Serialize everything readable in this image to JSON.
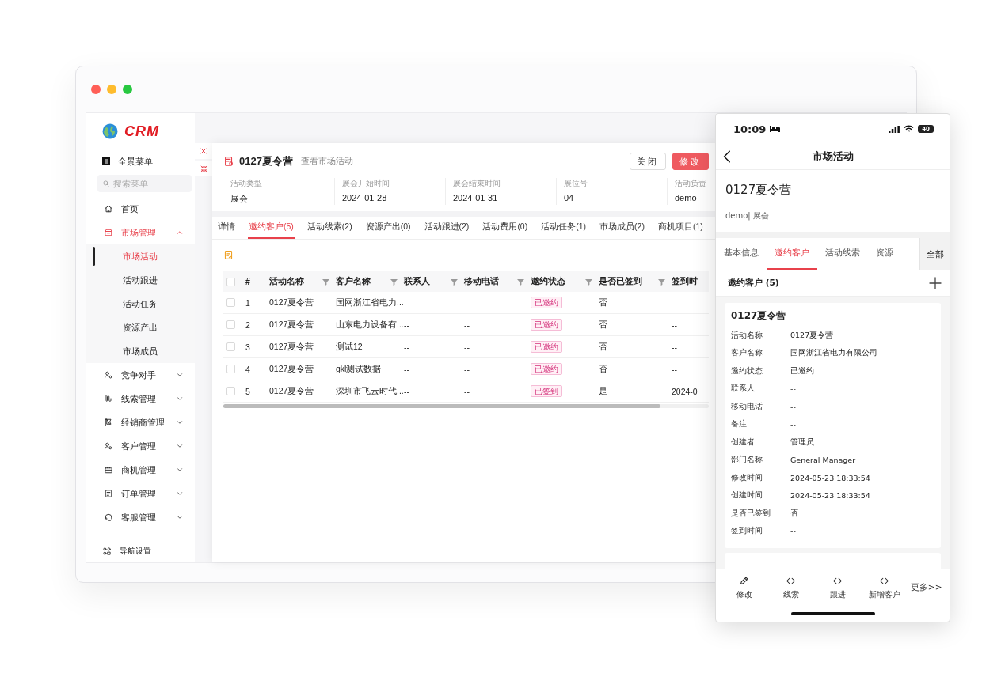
{
  "logo": "CRM",
  "sidebar": {
    "menu_label": "全景菜单",
    "search_placeholder": "搜索菜单",
    "footer": "导航设置",
    "items": [
      {
        "label": "首页",
        "kind": "link"
      },
      {
        "label": "市场管理",
        "kind": "group",
        "expanded": true,
        "children": [
          {
            "label": "市场活动",
            "selected": true
          },
          {
            "label": "活动跟进",
            "selected": false
          },
          {
            "label": "活动任务",
            "selected": false
          },
          {
            "label": "资源产出",
            "selected": false
          },
          {
            "label": "市场成员",
            "selected": false
          }
        ]
      },
      {
        "label": "竞争对手",
        "kind": "group",
        "expanded": false
      },
      {
        "label": "线索管理",
        "kind": "group",
        "expanded": false
      },
      {
        "label": "经销商管理",
        "kind": "group",
        "expanded": false
      },
      {
        "label": "客户管理",
        "kind": "group",
        "expanded": false
      },
      {
        "label": "商机管理",
        "kind": "group",
        "expanded": false
      },
      {
        "label": "订单管理",
        "kind": "group",
        "expanded": false
      },
      {
        "label": "客服管理",
        "kind": "group",
        "expanded": false
      }
    ]
  },
  "drawer": {
    "title": "0127夏令营",
    "subtitle": "查看市场活动",
    "buttons": [
      {
        "label": "关闭",
        "kind": "default"
      },
      {
        "label": "修改",
        "kind": "primary"
      }
    ],
    "fields": [
      {
        "label": "活动类型",
        "value": "展会"
      },
      {
        "label": "展会开始时间",
        "value": "2024-01-28"
      },
      {
        "label": "展会结束时间",
        "value": "2024-01-31"
      },
      {
        "label": "展位号",
        "value": "04"
      },
      {
        "label": "活动负责",
        "value": "demo"
      }
    ],
    "tabs": [
      {
        "label": "详情",
        "selected": false
      },
      {
        "label": "邀约客户(5)",
        "selected": true
      },
      {
        "label": "活动线索(2)",
        "selected": false
      },
      {
        "label": "资源产出(0)",
        "selected": false
      },
      {
        "label": "活动跟进(2)",
        "selected": false
      },
      {
        "label": "活动费用(0)",
        "selected": false
      },
      {
        "label": "活动任务(1)",
        "selected": false
      },
      {
        "label": "市场成员(2)",
        "selected": false
      },
      {
        "label": "商机项目(1)",
        "selected": false
      }
    ],
    "table": {
      "all_checked": false,
      "columns": [
        {
          "label": "#",
          "filter": false
        },
        {
          "label": "活动名称",
          "filter": true
        },
        {
          "label": "客户名称",
          "filter": true
        },
        {
          "label": "联系人",
          "filter": true
        },
        {
          "label": "移动电话",
          "filter": true
        },
        {
          "label": "邀约状态",
          "filter": true
        },
        {
          "label": "是否已签到",
          "filter": true
        },
        {
          "label": "签到时",
          "filter": false
        }
      ],
      "rows": [
        {
          "checked": false,
          "no": "1",
          "activity": "0127夏令营",
          "customer": "国网浙江省电力...",
          "contact": "--",
          "mobile": "--",
          "status": "已邀约",
          "signed_in": "否",
          "sign_time": "--"
        },
        {
          "checked": false,
          "no": "2",
          "activity": "0127夏令营",
          "customer": "山东电力设备有...",
          "contact": "--",
          "mobile": "--",
          "status": "已邀约",
          "signed_in": "否",
          "sign_time": "--"
        },
        {
          "checked": false,
          "no": "3",
          "activity": "0127夏令营",
          "customer": "测试12",
          "contact": "--",
          "mobile": "--",
          "status": "已邀约",
          "signed_in": "否",
          "sign_time": "--"
        },
        {
          "checked": false,
          "no": "4",
          "activity": "0127夏令营",
          "customer": "gkl测试数据",
          "contact": "--",
          "mobile": "--",
          "status": "已邀约",
          "signed_in": "否",
          "sign_time": "--"
        },
        {
          "checked": false,
          "no": "5",
          "activity": "0127夏令营",
          "customer": "深圳市飞云时代...",
          "contact": "--",
          "mobile": "--",
          "status": "已签到",
          "signed_in": "是",
          "sign_time": "2024-0"
        }
      ]
    }
  },
  "phone": {
    "time": "10:09",
    "battery": "40",
    "title": "市场活动",
    "name": "0127夏令营",
    "meta": "demo| 展会",
    "tabs": [
      {
        "label": "基本信息",
        "selected": false
      },
      {
        "label": "邀约客户",
        "selected": true
      },
      {
        "label": "活动线索",
        "selected": false
      },
      {
        "label": "资源",
        "selected": false
      }
    ],
    "all_button": "全部",
    "section": "邀约客户 (5)",
    "card": {
      "title": "0127夏令营",
      "rows": [
        {
          "label": "活动名称",
          "value": "0127夏令营"
        },
        {
          "label": "客户名称",
          "value": "国网浙江省电力有限公司"
        },
        {
          "label": "邀约状态",
          "value": "已邀约"
        },
        {
          "label": "联系人",
          "value": "--"
        },
        {
          "label": "移动电话",
          "value": "--"
        },
        {
          "label": "备注",
          "value": "--"
        },
        {
          "label": "创建者",
          "value": "管理员"
        },
        {
          "label": "部门名称",
          "value": "General Manager"
        },
        {
          "label": "修改时间",
          "value": "2024-05-23 18:33:54"
        },
        {
          "label": "创建时间",
          "value": "2024-05-23 18:33:54"
        },
        {
          "label": "是否已签到",
          "value": "否"
        },
        {
          "label": "签到时间",
          "value": "--"
        }
      ]
    },
    "actions": [
      {
        "label": "修改",
        "kind": "edit"
      },
      {
        "label": "线索",
        "kind": "code"
      },
      {
        "label": "跟进",
        "kind": "code"
      },
      {
        "label": "新增客户",
        "kind": "code"
      }
    ],
    "more": "更多>>"
  }
}
